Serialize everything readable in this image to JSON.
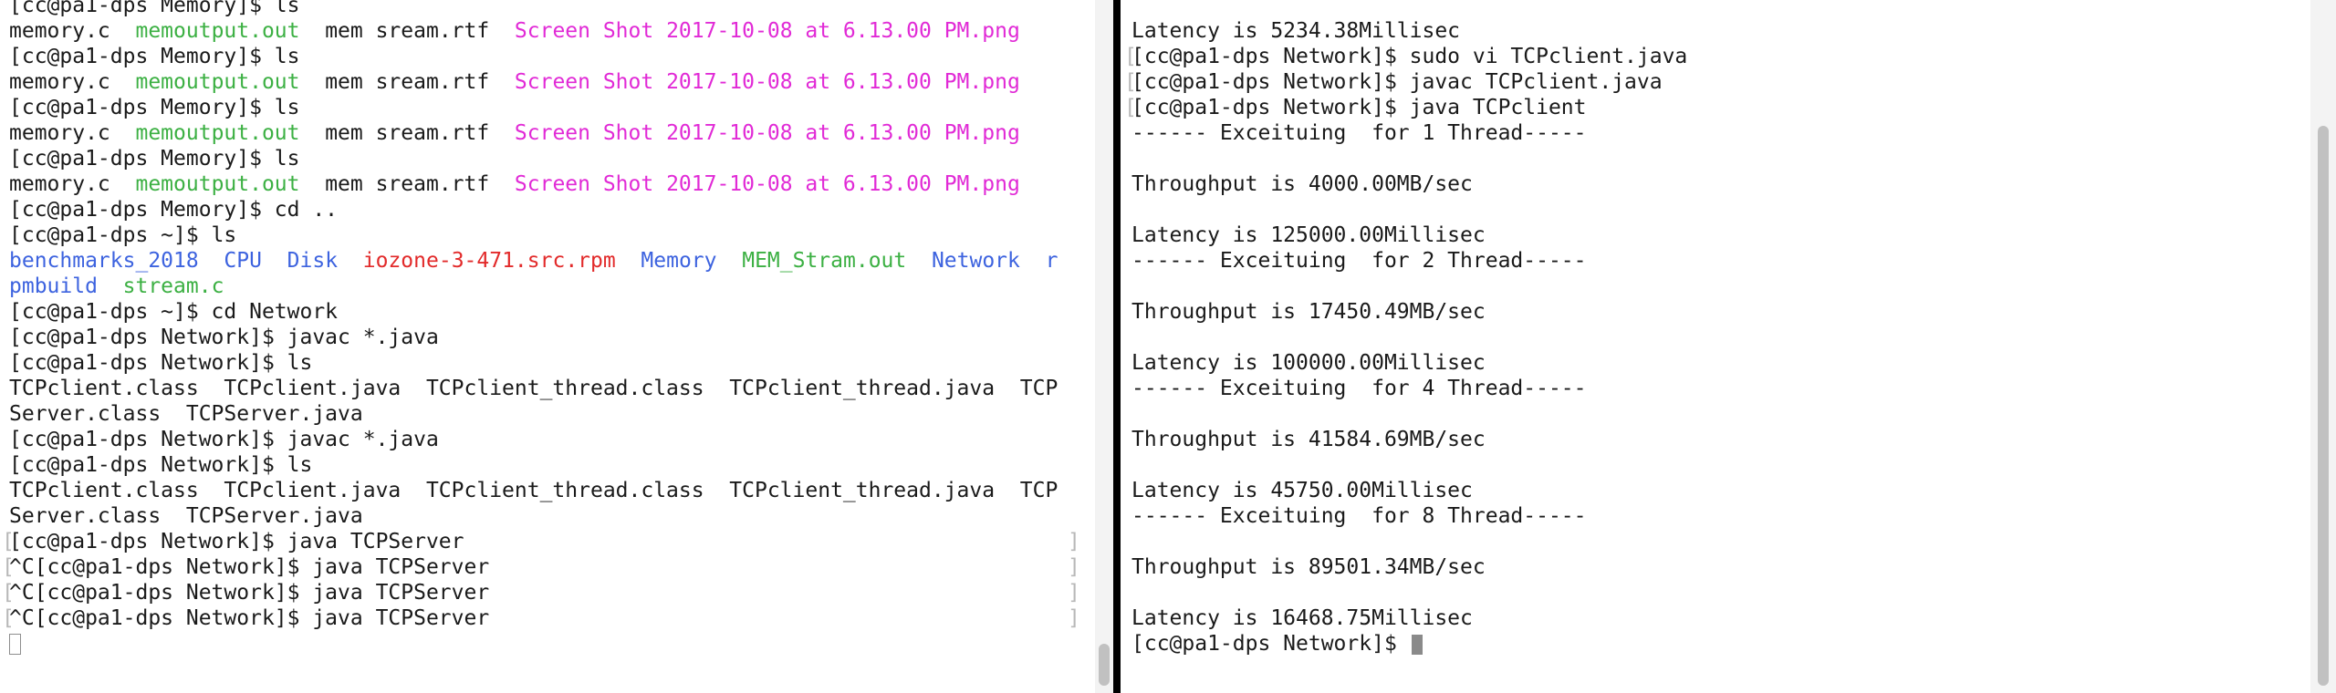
{
  "colors": {
    "default": "#1a1a1a",
    "green": "#3cb043",
    "magenta": "#e12ad6",
    "blue": "#3d63df",
    "red": "#e22a2a",
    "bracket": "#b8b8b8"
  },
  "left": {
    "lines": [
      {
        "segs": [
          {
            "t": "[cc@pa1-dps Memory]$ ls",
            "c": "default"
          }
        ]
      },
      {
        "segs": [
          {
            "t": "memory.c  ",
            "c": "default"
          },
          {
            "t": "memoutput.out",
            "c": "green"
          },
          {
            "t": "  mem sream.rtf  ",
            "c": "default"
          },
          {
            "t": "Screen Shot 2017-10-08 at 6.13.00 PM.png",
            "c": "magenta"
          }
        ]
      },
      {
        "segs": [
          {
            "t": "[cc@pa1-dps Memory]$ ls",
            "c": "default"
          }
        ]
      },
      {
        "segs": [
          {
            "t": "memory.c  ",
            "c": "default"
          },
          {
            "t": "memoutput.out",
            "c": "green"
          },
          {
            "t": "  mem sream.rtf  ",
            "c": "default"
          },
          {
            "t": "Screen Shot 2017-10-08 at 6.13.00 PM.png",
            "c": "magenta"
          }
        ]
      },
      {
        "segs": [
          {
            "t": "[cc@pa1-dps Memory]$ ls",
            "c": "default"
          }
        ]
      },
      {
        "segs": [
          {
            "t": "memory.c  ",
            "c": "default"
          },
          {
            "t": "memoutput.out",
            "c": "green"
          },
          {
            "t": "  mem sream.rtf  ",
            "c": "default"
          },
          {
            "t": "Screen Shot 2017-10-08 at 6.13.00 PM.png",
            "c": "magenta"
          }
        ]
      },
      {
        "segs": [
          {
            "t": "[cc@pa1-dps Memory]$ ls",
            "c": "default"
          }
        ]
      },
      {
        "segs": [
          {
            "t": "memory.c  ",
            "c": "default"
          },
          {
            "t": "memoutput.out",
            "c": "green"
          },
          {
            "t": "  mem sream.rtf  ",
            "c": "default"
          },
          {
            "t": "Screen Shot 2017-10-08 at 6.13.00 PM.png",
            "c": "magenta"
          }
        ]
      },
      {
        "segs": [
          {
            "t": "[cc@pa1-dps Memory]$ cd ..",
            "c": "default"
          }
        ]
      },
      {
        "segs": [
          {
            "t": "[cc@pa1-dps ~]$ ls",
            "c": "default"
          }
        ]
      },
      {
        "segs": [
          {
            "t": "benchmarks_2018",
            "c": "blue"
          },
          {
            "t": "  ",
            "c": "default"
          },
          {
            "t": "CPU",
            "c": "blue"
          },
          {
            "t": "  ",
            "c": "default"
          },
          {
            "t": "Disk",
            "c": "blue"
          },
          {
            "t": "  ",
            "c": "default"
          },
          {
            "t": "iozone-3-471.src.rpm",
            "c": "red"
          },
          {
            "t": "  ",
            "c": "default"
          },
          {
            "t": "Memory",
            "c": "blue"
          },
          {
            "t": "  ",
            "c": "default"
          },
          {
            "t": "MEM_Stram.out",
            "c": "green"
          },
          {
            "t": "  ",
            "c": "default"
          },
          {
            "t": "Network",
            "c": "blue"
          },
          {
            "t": "  ",
            "c": "default"
          },
          {
            "t": "r",
            "c": "blue"
          }
        ]
      },
      {
        "segs": [
          {
            "t": "pmbuild",
            "c": "blue"
          },
          {
            "t": "  ",
            "c": "default"
          },
          {
            "t": "stream.c",
            "c": "green"
          }
        ]
      },
      {
        "segs": [
          {
            "t": "[cc@pa1-dps ~]$ cd Network",
            "c": "default"
          }
        ]
      },
      {
        "segs": [
          {
            "t": "[cc@pa1-dps Network]$ javac *.java",
            "c": "default"
          }
        ]
      },
      {
        "segs": [
          {
            "t": "[cc@pa1-dps Network]$ ls",
            "c": "default"
          }
        ]
      },
      {
        "segs": [
          {
            "t": "TCPclient.class  TCPclient.java  TCPclient_thread.class  TCPclient_thread.java  TCP",
            "c": "default"
          }
        ]
      },
      {
        "segs": [
          {
            "t": "Server.class  TCPServer.java",
            "c": "default"
          }
        ]
      },
      {
        "segs": [
          {
            "t": "[cc@pa1-dps Network]$ javac *.java",
            "c": "default"
          }
        ]
      },
      {
        "segs": [
          {
            "t": "[cc@pa1-dps Network]$ ls",
            "c": "default"
          }
        ]
      },
      {
        "segs": [
          {
            "t": "TCPclient.class  TCPclient.java  TCPclient_thread.class  TCPclient_thread.java  TCP",
            "c": "default"
          }
        ]
      },
      {
        "segs": [
          {
            "t": "Server.class  TCPServer.java",
            "c": "default"
          }
        ]
      },
      {
        "segs": [
          {
            "t": "[cc@pa1-dps Network]$ java TCPServer",
            "c": "default"
          }
        ],
        "lb": true,
        "rb": true
      },
      {
        "segs": [
          {
            "t": "^C[cc@pa1-dps Network]$ java TCPServer",
            "c": "default"
          }
        ],
        "lb": true,
        "rb": true
      },
      {
        "segs": [
          {
            "t": "^C[cc@pa1-dps Network]$ java TCPServer",
            "c": "default"
          }
        ],
        "lb": true,
        "rb": true
      },
      {
        "segs": [
          {
            "t": "^C[cc@pa1-dps Network]$ java TCPServer",
            "c": "default"
          }
        ],
        "lb": true,
        "rb": true
      },
      {
        "segs": [],
        "cursor": "hollow"
      }
    ]
  },
  "right": {
    "lines": [
      {
        "segs": [
          {
            "t": "",
            "c": "default"
          }
        ]
      },
      {
        "segs": [
          {
            "t": "Latency is 5234.38Millisec",
            "c": "default"
          }
        ]
      },
      {
        "segs": [
          {
            "t": "[cc@pa1-dps Network]$ sudo vi TCPclient.java",
            "c": "default"
          }
        ],
        "lb": true,
        "rb": true
      },
      {
        "segs": [
          {
            "t": "[cc@pa1-dps Network]$ javac TCPclient.java",
            "c": "default"
          }
        ],
        "lb": true,
        "rb": true
      },
      {
        "segs": [
          {
            "t": "[cc@pa1-dps Network]$ java TCPclient",
            "c": "default"
          }
        ],
        "lb": true,
        "rb": true
      },
      {
        "segs": [
          {
            "t": "------ Exceituing  for 1 Thread-----",
            "c": "default"
          }
        ]
      },
      {
        "segs": [
          {
            "t": "",
            "c": "default"
          }
        ]
      },
      {
        "segs": [
          {
            "t": "Throughput is 4000.00MB/sec",
            "c": "default"
          }
        ]
      },
      {
        "segs": [
          {
            "t": "",
            "c": "default"
          }
        ]
      },
      {
        "segs": [
          {
            "t": "Latency is 125000.00Millisec",
            "c": "default"
          }
        ]
      },
      {
        "segs": [
          {
            "t": "------ Exceituing  for 2 Thread-----",
            "c": "default"
          }
        ]
      },
      {
        "segs": [
          {
            "t": "",
            "c": "default"
          }
        ]
      },
      {
        "segs": [
          {
            "t": "Throughput is 17450.49MB/sec",
            "c": "default"
          }
        ]
      },
      {
        "segs": [
          {
            "t": "",
            "c": "default"
          }
        ]
      },
      {
        "segs": [
          {
            "t": "Latency is 100000.00Millisec",
            "c": "default"
          }
        ]
      },
      {
        "segs": [
          {
            "t": "------ Exceituing  for 4 Thread-----",
            "c": "default"
          }
        ]
      },
      {
        "segs": [
          {
            "t": "",
            "c": "default"
          }
        ]
      },
      {
        "segs": [
          {
            "t": "Throughput is 41584.69MB/sec",
            "c": "default"
          }
        ]
      },
      {
        "segs": [
          {
            "t": "",
            "c": "default"
          }
        ]
      },
      {
        "segs": [
          {
            "t": "Latency is 45750.00Millisec",
            "c": "default"
          }
        ]
      },
      {
        "segs": [
          {
            "t": "------ Exceituing  for 8 Thread-----",
            "c": "default"
          }
        ]
      },
      {
        "segs": [
          {
            "t": "",
            "c": "default"
          }
        ]
      },
      {
        "segs": [
          {
            "t": "Throughput is 89501.34MB/sec",
            "c": "default"
          }
        ]
      },
      {
        "segs": [
          {
            "t": "",
            "c": "default"
          }
        ]
      },
      {
        "segs": [
          {
            "t": "Latency is 16468.75Millisec",
            "c": "default"
          }
        ]
      },
      {
        "segs": [
          {
            "t": "[cc@pa1-dps Network]$ ",
            "c": "default"
          }
        ],
        "cursor": "solid"
      }
    ]
  },
  "brackets": {
    "left": "[",
    "right": "]"
  }
}
